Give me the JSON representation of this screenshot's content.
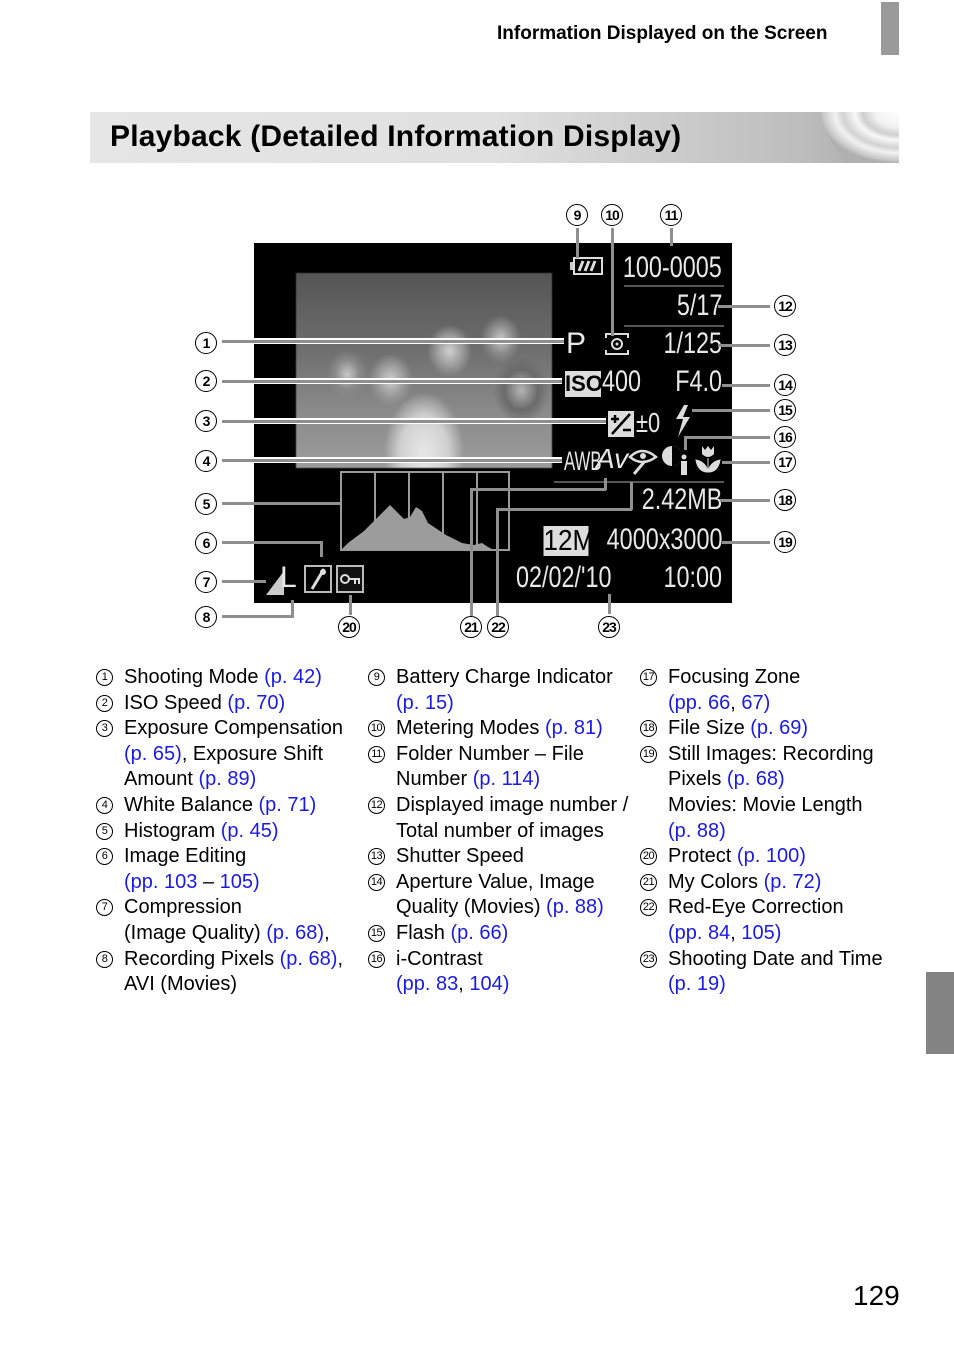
{
  "header": {
    "section_title": "Information Displayed on the Screen"
  },
  "title": "Playback (Detailed Information Display)",
  "screen": {
    "folder_file_number": "100-0005",
    "image_count": "5/17",
    "shooting_mode": "P",
    "shutter_speed": "1/125",
    "iso_label": "ISO",
    "iso_value": "400",
    "aperture": "F4.0",
    "exposure_comp": "±0",
    "white_balance": "AWB",
    "my_colors": "Av",
    "file_size": "2.42MB",
    "recording_pixels_badge": "12M",
    "resolution": "4000x3000",
    "date": "02/02/'10",
    "time": "10:00",
    "compression": "L",
    "icons": {
      "battery": "battery-full-icon",
      "metering": "metering-mode-icon",
      "exposure": "exposure-compensation-icon",
      "flash": "flash-icon",
      "contrast": "i-contrast-icon",
      "focus": "macro-flower-icon",
      "redeye": "red-eye-correction-icon",
      "edit": "image-editing-icon",
      "protect": "protect-key-icon",
      "compression": "compression-icon"
    }
  },
  "callouts": [
    "1",
    "2",
    "3",
    "4",
    "5",
    "6",
    "7",
    "8",
    "9",
    "10",
    "11",
    "12",
    "13",
    "14",
    "15",
    "16",
    "17",
    "18",
    "19",
    "20",
    "21",
    "22",
    "23"
  ],
  "legend": {
    "col1": [
      {
        "n": "1",
        "parts": [
          [
            "Shooting Mode ",
            ""
          ],
          [
            "(p. 42)",
            "ref"
          ]
        ]
      },
      {
        "n": "2",
        "parts": [
          [
            "ISO Speed ",
            ""
          ],
          [
            "(p. 70)",
            "ref"
          ]
        ]
      },
      {
        "n": "3",
        "parts": [
          [
            "Exposure Compensation ",
            ""
          ],
          [
            "(p. 65)",
            "ref"
          ],
          [
            ", Exposure Shift Amount ",
            ""
          ],
          [
            "(p. 89)",
            "ref"
          ]
        ]
      },
      {
        "n": "4",
        "parts": [
          [
            "White Balance ",
            ""
          ],
          [
            "(p. 71)",
            "ref"
          ]
        ]
      },
      {
        "n": "5",
        "parts": [
          [
            "Histogram ",
            ""
          ],
          [
            "(p. 45)",
            "ref"
          ]
        ]
      },
      {
        "n": "6",
        "parts": [
          [
            "Image Editing",
            ""
          ],
          [
            "\n",
            ""
          ],
          [
            "(pp. 103",
            "ref"
          ],
          [
            " – ",
            ""
          ],
          [
            "105)",
            "ref"
          ]
        ]
      },
      {
        "n": "7",
        "parts": [
          [
            "Compression",
            ""
          ],
          [
            "\n",
            ""
          ],
          [
            "(Image Quality) ",
            ""
          ],
          [
            "(p. 68)",
            "ref"
          ],
          [
            ",",
            ""
          ]
        ]
      },
      {
        "n": "8",
        "parts": [
          [
            "Recording Pixels ",
            ""
          ],
          [
            "(p. 68)",
            "ref"
          ],
          [
            ", AVI (Movies)",
            ""
          ]
        ]
      }
    ],
    "col2": [
      {
        "n": "9",
        "parts": [
          [
            "Battery Charge Indicator ",
            ""
          ],
          [
            "(p. 15)",
            "ref"
          ]
        ]
      },
      {
        "n": "10",
        "parts": [
          [
            "Metering Modes ",
            ""
          ],
          [
            "(p. 81)",
            "ref"
          ]
        ]
      },
      {
        "n": "11",
        "parts": [
          [
            "Folder Number – File Number ",
            ""
          ],
          [
            "(p. 114)",
            "ref"
          ]
        ]
      },
      {
        "n": "12",
        "parts": [
          [
            "Displayed image number / Total number of images",
            ""
          ]
        ]
      },
      {
        "n": "13",
        "parts": [
          [
            "Shutter Speed",
            ""
          ]
        ]
      },
      {
        "n": "14",
        "parts": [
          [
            "Aperture Value, Image Quality (Movies) ",
            ""
          ],
          [
            "(p. 88)",
            "ref"
          ]
        ]
      },
      {
        "n": "15",
        "parts": [
          [
            "Flash ",
            ""
          ],
          [
            "(p. 66)",
            "ref"
          ]
        ]
      },
      {
        "n": "16",
        "parts": [
          [
            "i-Contrast",
            ""
          ],
          [
            "\n",
            ""
          ],
          [
            "(pp. 83",
            "ref"
          ],
          [
            ", ",
            ""
          ],
          [
            "104)",
            "ref"
          ]
        ]
      }
    ],
    "col3": [
      {
        "n": "17",
        "parts": [
          [
            "Focusing Zone",
            ""
          ],
          [
            "\n",
            ""
          ],
          [
            "(pp. 66",
            "ref"
          ],
          [
            ", ",
            ""
          ],
          [
            "67)",
            "ref"
          ]
        ]
      },
      {
        "n": "18",
        "parts": [
          [
            "File Size ",
            ""
          ],
          [
            "(p. 69)",
            "ref"
          ]
        ]
      },
      {
        "n": "19",
        "parts": [
          [
            "Still Images: Recording Pixels ",
            ""
          ],
          [
            "(p. 68)",
            "ref"
          ],
          [
            "\n",
            ""
          ],
          [
            "Movies: Movie Length",
            ""
          ],
          [
            "\n",
            ""
          ],
          [
            "(p. 88)",
            "ref"
          ]
        ]
      },
      {
        "n": "20",
        "parts": [
          [
            "Protect ",
            ""
          ],
          [
            "(p. 100)",
            "ref"
          ]
        ]
      },
      {
        "n": "21",
        "parts": [
          [
            "My Colors ",
            ""
          ],
          [
            "(p. 72)",
            "ref"
          ]
        ]
      },
      {
        "n": "22",
        "parts": [
          [
            "Red-Eye Correction",
            ""
          ],
          [
            "\n",
            ""
          ],
          [
            "(pp. 84",
            "ref"
          ],
          [
            ", ",
            ""
          ],
          [
            "105)",
            "ref"
          ]
        ]
      },
      {
        "n": "23",
        "parts": [
          [
            "Shooting Date and Time",
            ""
          ],
          [
            "\n",
            ""
          ],
          [
            "(p. 19)",
            "ref"
          ]
        ]
      }
    ]
  },
  "page_number": "129",
  "colors": {
    "link": "#1a1ae6",
    "title_bar": "#e0e0e0",
    "tab": "#9a9a9a"
  }
}
